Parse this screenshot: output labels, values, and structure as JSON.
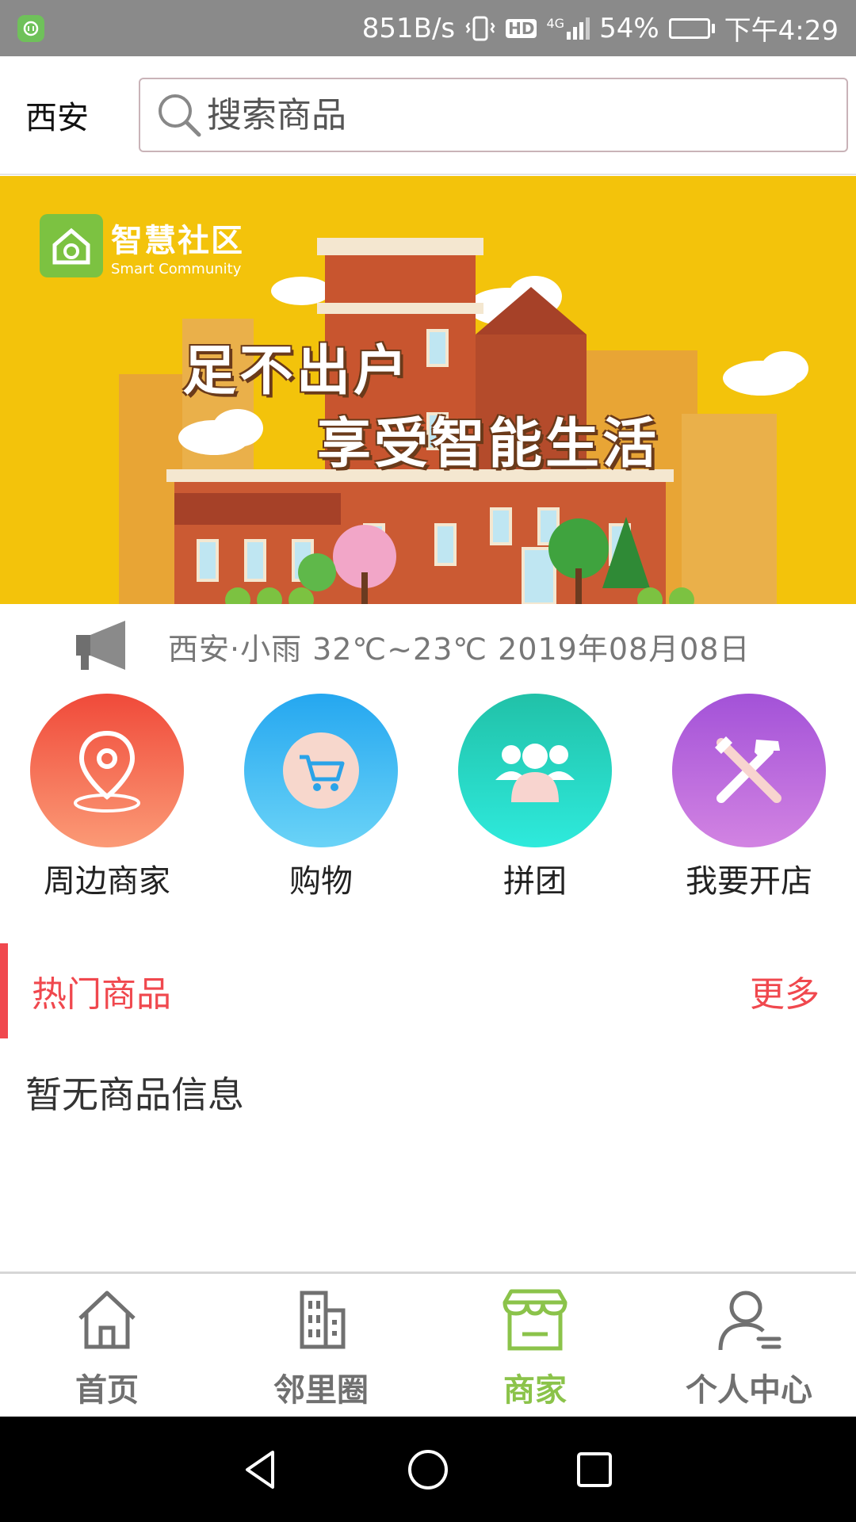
{
  "status_bar": {
    "net_speed": "851B/s",
    "hd": "HD",
    "signal": "4G",
    "battery": "54%",
    "battery_level": 0.54,
    "time": "下午4:29"
  },
  "header": {
    "city": "西安",
    "search": {
      "placeholder": "搜索商品",
      "value": ""
    }
  },
  "banner": {
    "logo_cn": "智慧社区",
    "logo_en": "Smart Community",
    "slogan_line1": "足不出户",
    "slogan_line2": "享受智能生活",
    "background": "#f3c30b"
  },
  "notice": {
    "icon": "megaphone-icon",
    "text": "西安·小雨   32℃~23℃   2019年08月08日"
  },
  "quick_menu": [
    {
      "label": "周边商家",
      "icon": "location-pin-icon",
      "color_top": "#f04a3a",
      "color_bottom": "#fb9a76"
    },
    {
      "label": "购物",
      "icon": "shopping-cart-icon",
      "color_top": "#25a7f0",
      "color_bottom": "#6ad3f7"
    },
    {
      "label": "拼团",
      "icon": "group-icon",
      "color_top": "#21c1a8",
      "color_bottom": "#2eeadc"
    },
    {
      "label": "我要开店",
      "icon": "tools-icon",
      "color_top": "#a352d8",
      "color_bottom": "#d283e2"
    }
  ],
  "hot_goods": {
    "title": "热门商品",
    "more": "更多",
    "empty_text": "暂无商品信息",
    "accent": "#f0484e"
  },
  "bottom_nav": {
    "items": [
      {
        "label": "首页",
        "icon": "home-icon",
        "active": false
      },
      {
        "label": "邻里圈",
        "icon": "building-icon",
        "active": false
      },
      {
        "label": "商家",
        "icon": "storefront-icon",
        "active": true
      },
      {
        "label": "个人中心",
        "icon": "user-icon",
        "active": false
      }
    ],
    "active_color": "#8bc34a"
  }
}
